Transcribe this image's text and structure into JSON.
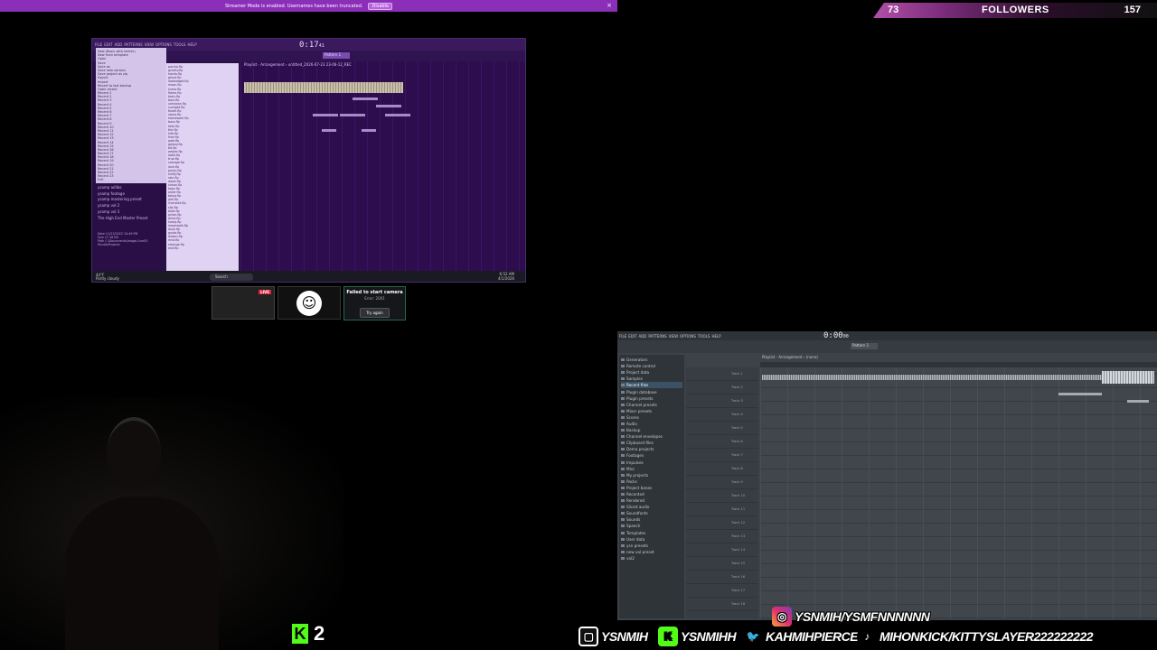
{
  "streamer_banner": {
    "message": "Streamer Mode is enabled. Usernames have been truncated.",
    "disable_label": "Disable",
    "close_glyph": "×"
  },
  "followers": {
    "left_count": "73",
    "title": "FOLLOWERS",
    "right_count": "157",
    "gradient_color": "#b24fa8"
  },
  "fl_top": {
    "menu": [
      "FILE",
      "EDIT",
      "ADD",
      "PATTERNS",
      "VIEW",
      "OPTIONS",
      "TOOLS",
      "HELP"
    ],
    "time": "0:17",
    "time_sub": "41",
    "pattern_label": "Pattern 1",
    "playlist_title": "Playlist - Arrangement › untitled_2026-07-23 23-06-12_REC",
    "browser_menu_items": [
      "New (Basic with limiter)",
      "New from template",
      "Open",
      "Save",
      "Save as",
      "Save new version",
      "Save project as zip",
      "Export",
      "Import",
      "Revert to last backup",
      "Open recent",
      "Recent 1",
      "Recent 2",
      "Recent 3",
      "Recent 4",
      "Recent 5",
      "Recent 6",
      "Recent 7",
      "Recent 8",
      "Recent 9",
      "Recent 10",
      "Recent 11",
      "Recent 12",
      "Recent 13",
      "Recent 14",
      "Recent 15",
      "Recent 16",
      "Recent 17",
      "Recent 18",
      "Recent 19",
      "Recent 20",
      "Recent 21",
      "Recent 22",
      "Recent 23",
      "Exit"
    ],
    "file_list": [
      "pacino.flp",
      "gravity.flp",
      "hands.flp",
      "ghost.flp",
      "lowbudget.flp",
      "moon.flp",
      "kumo.flp",
      "flame.flp",
      "tools.flp",
      "bars.flp",
      "unknown.flp",
      "sunlight.flp",
      "thaeli.flp",
      "stone.flp",
      "homework.flp",
      "bass.flp",
      "ketu.flp",
      "the.flp",
      "kite.flp",
      "free.flp",
      "pale.flp",
      "galaxy.flp",
      "bit.flp",
      "amber.flp",
      "ladle.flp",
      "true.flp",
      "salvage.flp",
      "love.flp",
      "pump.flp",
      "kinfly.flp",
      "rain.flp",
      "wave.flp",
      "simon.flp",
      "kosa.flp",
      "outer.flp",
      "tokyo.flp",
      "jam.flp",
      "riverside.flp",
      "slip.flp",
      "beat.flp",
      "prism.flp",
      "drive.flp",
      "kamp.flp",
      "moonwalk.flp",
      "dusk.flp",
      "gusto.flp",
      "dream.flp",
      "mist.flp",
      "strange.flp",
      "end.flp"
    ],
    "recent": [
      "ysamp adlibs vibetech",
      "ysamp adlibs",
      "ysamp footage",
      "ysamp mastering preset",
      "ysamp vol 2",
      "ysamp vol 3",
      "The High End Master Preset"
    ],
    "info": [
      "Date   11/23/2022 10:49 PM",
      "Size   17.16 KB",
      "Path   C:\\Documents\\Image-Line\\FL Studio\\Projects"
    ],
    "taskbar": {
      "weather_temp": "44°F",
      "weather_desc": "Partly cloudy",
      "search": "Search",
      "time": "6:52 AM",
      "date": "4/1/2026"
    }
  },
  "cameras": {
    "live_badge": "LIVE",
    "avatar_glyph": "☺",
    "error_title": "Failed to start camera",
    "error_detail": "Error: 2001",
    "try_again_label": "Try again"
  },
  "kick_counter": {
    "logo": "K",
    "value": "2",
    "color": "#53fc18"
  },
  "fl_bottom": {
    "menu": [
      "FILE",
      "EDIT",
      "ADD",
      "PATTERNS",
      "VIEW",
      "OPTIONS",
      "TOOLS",
      "HELP"
    ],
    "time": "0:00",
    "time_sub": "00",
    "pattern_label": "Pattern 1",
    "playlist_title": "Playlist - Arrangement › (none)",
    "browser": [
      "Generators",
      "Remote control",
      "Project data",
      "Samples",
      "Recent files",
      "Plugin database",
      "Plugin presets",
      "Channel presets",
      "Mixer presets",
      "Scores",
      "Audio",
      "Backup",
      "Channel envelopes",
      "Clipboard files",
      "Demo projects",
      "Footages",
      "Impulses",
      "Misc",
      "My projects",
      "Packs",
      "Project bones",
      "Recorded",
      "Rendered",
      "Sliced audio",
      "Soundfonts",
      "Sounds",
      "Speech",
      "Templates",
      "User data",
      "ysn presets",
      "new vol preset",
      "vol2"
    ],
    "tracks": [
      "Track 1",
      "Track 2",
      "Track 3",
      "Track 4",
      "Track 5",
      "Track 6",
      "Track 7",
      "Track 8",
      "Track 9",
      "Track 10",
      "Track 11",
      "Track 12",
      "Track 13",
      "Track 14",
      "Track 15",
      "Track 16",
      "Track 17",
      "Track 18"
    ]
  },
  "socials": {
    "instagram": "YSNMIH/YSMFNNNNNN",
    "twitch": "YSNMIH",
    "kick": "YSNMIHH",
    "twitter": "KAHMIHPIERCE",
    "tiktok": "MIHONKICK/KITTYSLAYER222222222"
  }
}
